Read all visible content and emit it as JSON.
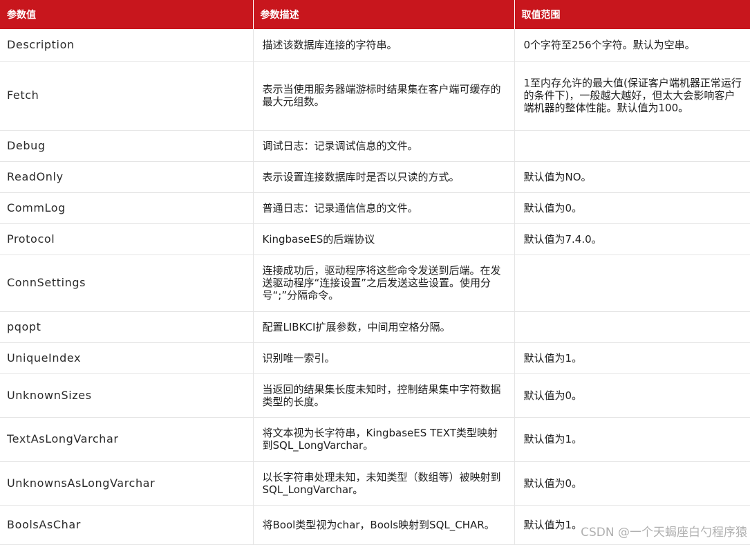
{
  "table": {
    "headers": [
      "参数值",
      "参数描述",
      "取值范围"
    ],
    "rows": [
      {
        "name": "Description",
        "desc": "描述该数据库连接的字符串。",
        "range": "0个字符至256个字符。默认为空串。"
      },
      {
        "name": "Fetch",
        "desc": "表示当使用服务器端游标时结果集在客户端可缓存的最大元组数。",
        "range": "1至内存允许的最大值(保证客户端机器正常运行的条件下)，一般越大越好，但太大会影响客户端机器的整体性能。默认值为100。"
      },
      {
        "name": "Debug",
        "desc": "调试日志：记录调试信息的文件。",
        "range": ""
      },
      {
        "name": "ReadOnly",
        "desc": "表示设置连接数据库时是否以只读的方式。",
        "range": "默认值为NO。"
      },
      {
        "name": "CommLog",
        "desc": "普通日志：记录通信信息的文件。",
        "range": "默认值为0。"
      },
      {
        "name": "Protocol",
        "desc": "KingbaseES的后端协议",
        "range": "默认值为7.4.0。"
      },
      {
        "name": "ConnSettings",
        "desc": "连接成功后，驱动程序将这些命令发送到后端。在发送驱动程序“连接设置”之后发送这些设置。使用分号“;”分隔命令。",
        "range": ""
      },
      {
        "name": "pqopt",
        "desc": "配置LIBKCI扩展参数，中间用空格分隔。",
        "range": ""
      },
      {
        "name": "UniqueIndex",
        "desc": "识别唯一索引。",
        "range": "默认值为1。"
      },
      {
        "name": "UnknownSizes",
        "desc": "当返回的结果集长度未知时，控制结果集中字符数据类型的长度。",
        "range": "默认值为0。"
      },
      {
        "name": "TextAsLongVarchar",
        "desc": "将文本视为长字符串，KingbaseES TEXT类型映射到SQL_LongVarchar。",
        "range": "默认值为1。"
      },
      {
        "name": "UnknownsAsLongVarchar",
        "desc": "以长字符串处理未知，未知类型（数组等）被映射到SQL_LongVarchar。",
        "range": "默认值为0。"
      },
      {
        "name": "BoolsAsChar",
        "desc": "将Bool类型视为char，Bools映射到SQL_CHAR。",
        "range": "默认值为1。"
      }
    ]
  },
  "watermark": "CSDN @一个天蝎座白勺程序猿",
  "colors": {
    "header_bg": "#c8161d",
    "header_text": "#ffffff",
    "grid": "#e5e5e5"
  }
}
